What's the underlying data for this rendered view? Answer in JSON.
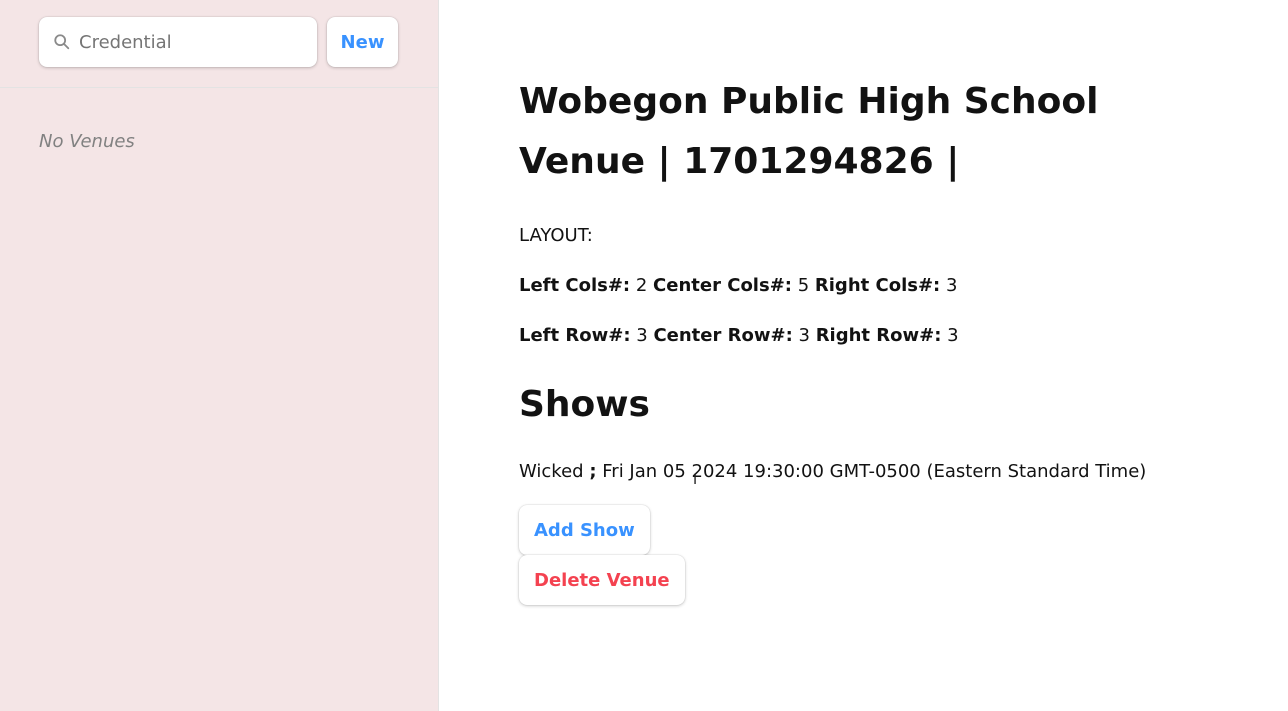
{
  "sidebar": {
    "search": {
      "value": "",
      "placeholder": "Credential",
      "icon": "search-icon"
    },
    "new_button": "New",
    "empty_text": "No Venues"
  },
  "venue": {
    "title": "Wobegon Public High School Venue | 1701294826 |",
    "layout_label": "LAYOUT:",
    "cols": {
      "left_label": "Left Cols#:",
      "left_value": "2",
      "center_label": "Center Cols#:",
      "center_value": "5",
      "right_label": "Right Cols#:",
      "right_value": "3"
    },
    "rows": {
      "left_label": "Left Row#:",
      "left_value": "3",
      "center_label": "Center Row#:",
      "center_value": "3",
      "right_label": "Right Row#:",
      "right_value": "3"
    }
  },
  "shows": {
    "heading": "Shows",
    "items": [
      {
        "name": "Wicked",
        "separator": ";",
        "datetime": "Fri Jan 05 2024 19:30:00 GMT-0500 (Eastern Standard Time)"
      }
    ],
    "add_button": "Add Show",
    "delete_button": "Delete Venue"
  },
  "colors": {
    "sidebar_bg": "#f4e5e6",
    "accent": "#3992ff",
    "danger": "#f44250"
  }
}
